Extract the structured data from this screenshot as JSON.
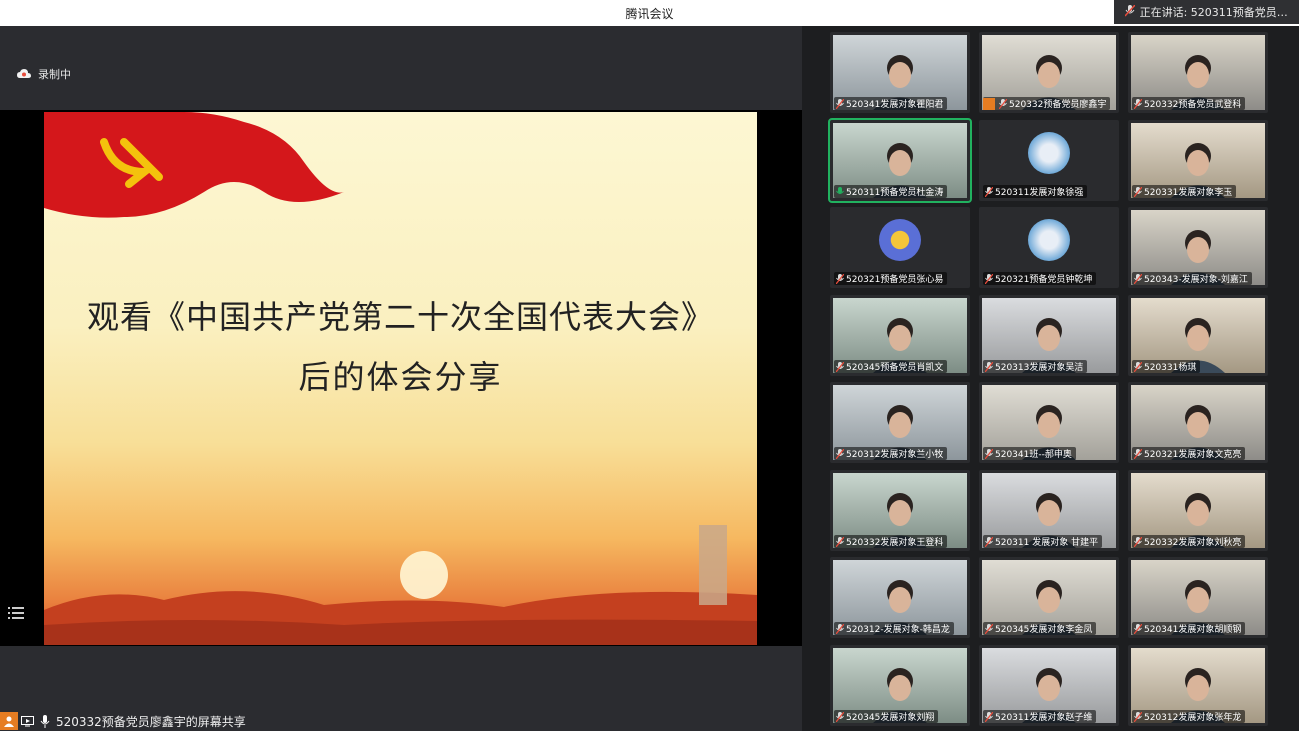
{
  "window": {
    "title": "腾讯会议"
  },
  "speaking": {
    "text": "正在讲话: 520311预备党员杜..."
  },
  "recording": {
    "label": "录制中"
  },
  "slide": {
    "line1": "观看《中国共产党第二十次全国代表大会》",
    "line2": "后的体会分享"
  },
  "share_bar": {
    "text": "520332预备党员廖鑫宇的屏幕共享"
  },
  "colors": {
    "active_border": "#21b25f",
    "host_badge": "#e67d22",
    "mic_on": "#21b25f"
  },
  "participants": [
    {
      "name": "520341发展对象瞿阳君",
      "type": "video"
    },
    {
      "name": "520332预备党员廖鑫宇",
      "type": "video",
      "host": true
    },
    {
      "name": "520332预备党员武登科",
      "type": "video"
    },
    {
      "name": "520311预备党员杜金涛",
      "type": "video",
      "active": true
    },
    {
      "name": "520311发展对象徐强",
      "type": "avatar"
    },
    {
      "name": "520331发展对象李玉",
      "type": "video"
    },
    {
      "name": "520321预备党员张心易",
      "type": "avatar"
    },
    {
      "name": "520321预备党员钟乾坤",
      "type": "avatar"
    },
    {
      "name": "520343-发展对象-刘嘉江",
      "type": "video"
    },
    {
      "name": "520345预备党员肖凯文",
      "type": "video"
    },
    {
      "name": "520313发展对象吴洁",
      "type": "video"
    },
    {
      "name": "520331杨琪",
      "type": "video"
    },
    {
      "name": "520312发展对象兰小牧",
      "type": "video"
    },
    {
      "name": "520341班--郝申奥",
      "type": "video"
    },
    {
      "name": "520321发展对象文克亮",
      "type": "video"
    },
    {
      "name": "520332发展对象王登科",
      "type": "video"
    },
    {
      "name": "520311 发展对象 甘建平",
      "type": "video"
    },
    {
      "name": "520332发展对象刘秋亮",
      "type": "video"
    },
    {
      "name": "520312-发展对象-韩昌龙",
      "type": "video"
    },
    {
      "name": "520345发展对象李金凤",
      "type": "video"
    },
    {
      "name": "520341发展对象胡顺钢",
      "type": "video"
    },
    {
      "name": "520345发展对象刘翔",
      "type": "video"
    },
    {
      "name": "520311发展对象赵子维",
      "type": "video"
    },
    {
      "name": "520312发展对象张年龙",
      "type": "video"
    }
  ]
}
